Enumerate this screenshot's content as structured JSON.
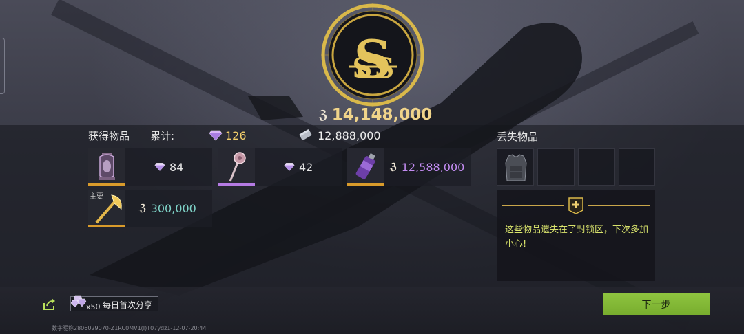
{
  "reward": {
    "total": "14,148,000"
  },
  "obtained": {
    "title": "获得物品",
    "cumulative_label": "累计:",
    "gem_total": "126",
    "coin_total": "12,888,000",
    "items": [
      {
        "name": "lantern",
        "value": "84",
        "currency": "gem"
      },
      {
        "name": "mace",
        "value": "42",
        "currency": "gem"
      },
      {
        "name": "spray-can",
        "value": "12,588,000",
        "currency": "coin"
      },
      {
        "name": "golden-axe",
        "tag": "主要",
        "value": "300,000",
        "currency": "coin"
      }
    ]
  },
  "lost": {
    "title": "丢失物品",
    "message": "这些物品遗失在了封锁区，下次多加小心!"
  },
  "share": {
    "count": "x50",
    "label": "每日首次分享"
  },
  "next_button": "下一步",
  "footer_id": "数字昵称2806029070-Z1RC0MV1(I)T07ydz1-12-07-20:44",
  "colors": {
    "gold": "#f0d48a",
    "gem_total": "#f2cf6b",
    "coin_purple": "#c38cf2",
    "coin_teal": "#7fd3c8",
    "notice_text": "#d9e36c",
    "next_button": "#86bd38"
  }
}
